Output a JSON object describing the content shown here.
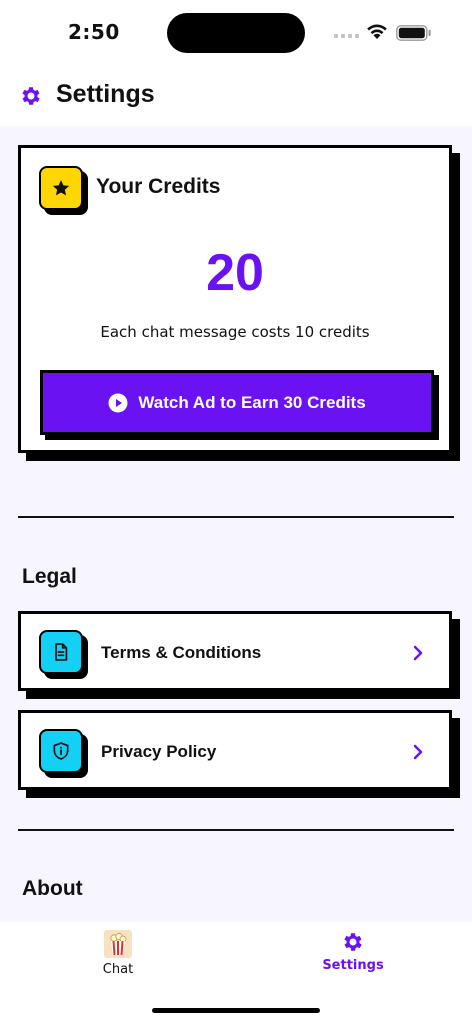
{
  "status_bar": {
    "time": "2:50"
  },
  "header": {
    "title": "Settings"
  },
  "credits": {
    "title": "Your Credits",
    "value": "20",
    "note": "Each chat message costs 10 credits",
    "watch_button_label": "Watch Ad to Earn 30 Credits"
  },
  "legal": {
    "title": "Legal",
    "items": [
      {
        "label": "Terms & Conditions",
        "icon": "document-icon"
      },
      {
        "label": "Privacy Policy",
        "icon": "shield-info-icon"
      }
    ]
  },
  "about": {
    "title": "About"
  },
  "tabs": [
    {
      "label": "Chat",
      "icon": "popcorn-icon",
      "active": false
    },
    {
      "label": "Settings",
      "icon": "gear-icon",
      "active": true
    }
  ],
  "colors": {
    "accent": "#6a12f2",
    "badge_yellow": "#ffd600",
    "badge_cyan": "#13d0f5",
    "background": "#f7f5fe"
  }
}
